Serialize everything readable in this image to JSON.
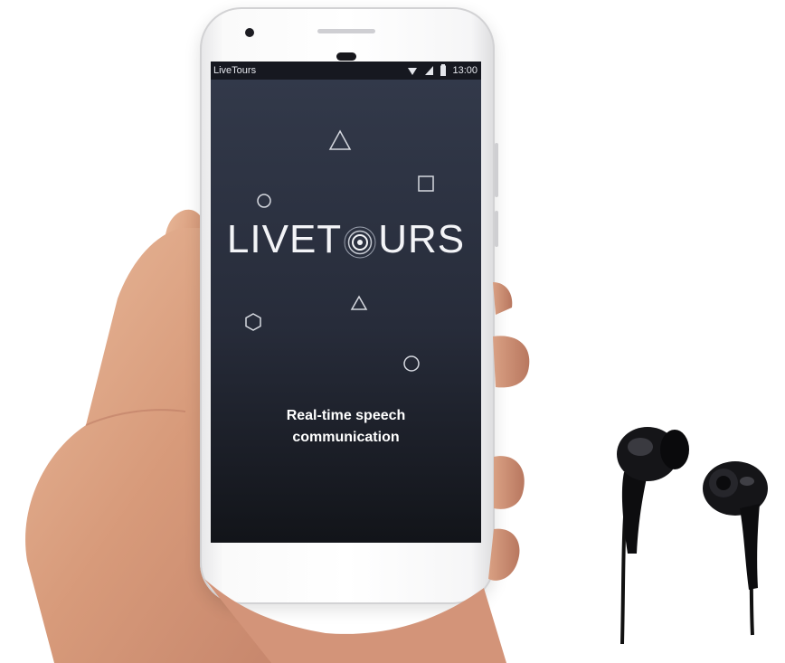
{
  "status_bar": {
    "app_name": "LiveTours",
    "time": "13:00",
    "icons": [
      "wifi-icon",
      "cell-signal-icon",
      "battery-icon"
    ]
  },
  "splash": {
    "logo_left": "LIVET",
    "logo_right": "URS",
    "tagline_line1": "Real-time speech",
    "tagline_line2": "communication"
  },
  "decorations": [
    "triangle-icon",
    "square-icon",
    "circle-icon",
    "hexagon-icon",
    "triangle-icon",
    "circle-icon"
  ],
  "colors": {
    "screen_top": "#333a4b",
    "screen_bottom": "#121419",
    "foreground": "#f3f4f7",
    "phone_body": "#ffffff"
  }
}
